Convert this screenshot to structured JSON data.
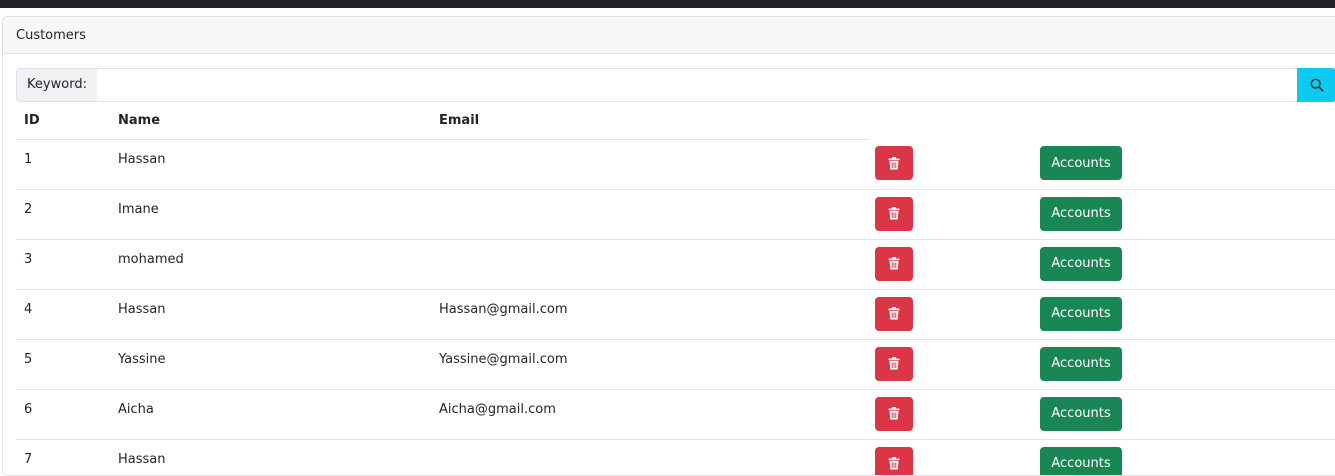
{
  "card": {
    "title": "Customers"
  },
  "search": {
    "label": "Keyword:",
    "value": "",
    "placeholder": ""
  },
  "table": {
    "headers": {
      "id": "ID",
      "name": "Name",
      "email": "Email"
    },
    "rows": [
      {
        "id": "1",
        "name": "Hassan",
        "email": ""
      },
      {
        "id": "2",
        "name": "Imane",
        "email": ""
      },
      {
        "id": "3",
        "name": "mohamed",
        "email": ""
      },
      {
        "id": "4",
        "name": "Hassan",
        "email": "Hassan@gmail.com"
      },
      {
        "id": "5",
        "name": "Yassine",
        "email": "Yassine@gmail.com"
      },
      {
        "id": "6",
        "name": "Aicha",
        "email": "Aicha@gmail.com"
      },
      {
        "id": "7",
        "name": "Hassan",
        "email": ""
      }
    ],
    "accounts_label": "Accounts"
  },
  "colors": {
    "delete": "#dc3545",
    "accounts": "#198754",
    "search_button": "#0dcaf0"
  },
  "icons": {
    "delete": "trash-icon",
    "search": "search-icon"
  }
}
